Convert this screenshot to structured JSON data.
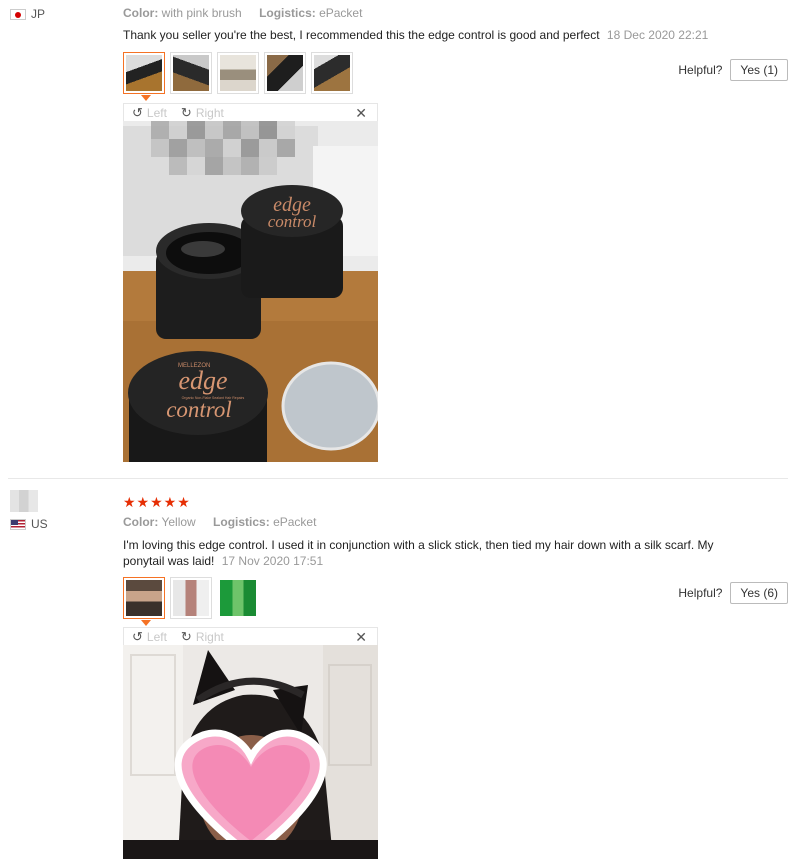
{
  "reviews": [
    {
      "country": "JP",
      "color_label": "Color:",
      "color_value": "with pink brush",
      "logistics_label": "Logistics:",
      "logistics_value": "ePacket",
      "text": "Thank you seller you're the best, I recommended this the edge control is good and perfect",
      "date": "18 Dec 2020 22:21",
      "helpful_label": "Helpful?",
      "yes_label": "Yes (1)",
      "viewer": {
        "left_label": "Left",
        "right_label": "Right"
      },
      "product_text": {
        "brand": "MELLEZON",
        "line1": "edge",
        "line2": "control",
        "tag": "Organic Non-Flake Sealant Hair Repairs"
      }
    },
    {
      "country": "US",
      "stars": "★★★★★",
      "color_label": "Color:",
      "color_value": "Yellow",
      "logistics_label": "Logistics:",
      "logistics_value": "ePacket",
      "text_line1": "I'm loving this edge control. I used it in conjunction with a slick stick, then tied my hair down with a silk scarf. My",
      "text_line2": "ponytail was laid!",
      "date": "17 Nov 2020 17:51",
      "helpful_label": "Helpful?",
      "yes_label": "Yes (6)",
      "viewer": {
        "left_label": "Left",
        "right_label": "Right"
      }
    }
  ],
  "colors": {
    "accent": "#f57224",
    "star": "#e62e04",
    "meta": "#999999"
  }
}
